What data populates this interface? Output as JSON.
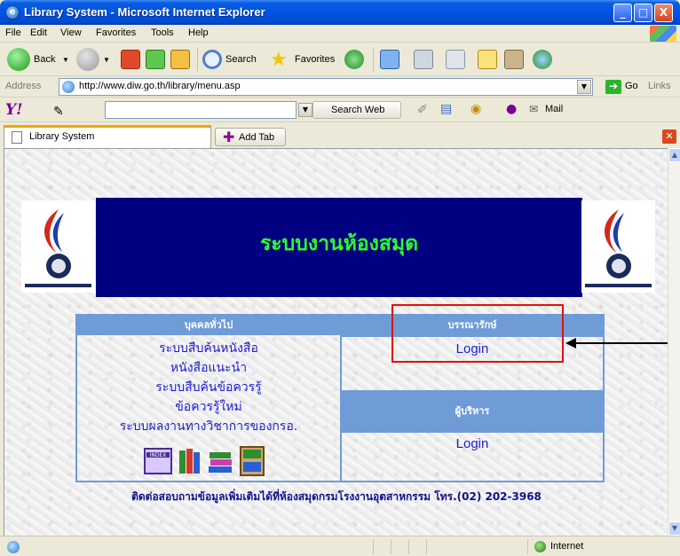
{
  "window": {
    "title": "Library System - Microsoft Internet Explorer",
    "icon": "ie-icon",
    "controls": {
      "minimize": "_",
      "maximize": "□",
      "close": "X"
    }
  },
  "menu": [
    "File",
    "Edit",
    "View",
    "Favorites",
    "Tools",
    "Help"
  ],
  "toolbar": {
    "back_label": "Back",
    "search_label": "Search",
    "favorites_label": "Favorites"
  },
  "address": {
    "label": "Address",
    "url": "http://www.diw.go.th/library/menu.asp",
    "go_label": "Go",
    "links_label": "Links"
  },
  "yahoo": {
    "logo": "Y!",
    "search_label": "Search Web",
    "mail_label": "Mail"
  },
  "tabs": {
    "active_label": "Library System",
    "add_tab_label": "Add Tab"
  },
  "page": {
    "banner_title": "ระบบงานห้องสมุด",
    "public": {
      "header": "บุคคลทั่วไป",
      "links": [
        "ระบบสืบค้นหนังสือ",
        "หนังสือแนะนำ",
        "ระบบสืบค้นข้อควรรู้",
        "ข้อควรรู้ใหม่",
        "ระบบผลงานทางวิชาการของกรอ."
      ]
    },
    "librarian": {
      "header": "บรรณารักษ์",
      "login": "Login"
    },
    "admin": {
      "header": "ผู้บริหาร",
      "login": "Login"
    },
    "footer": "ติดต่อสอบถามข้อมูลเพิ่มเติมได้ที่ห้องสมุดกรมโรงงานอุตสาหกรรม โทร.(02) 202-3968",
    "annotation_color": "#e01010"
  },
  "status": {
    "zone": "Internet"
  }
}
